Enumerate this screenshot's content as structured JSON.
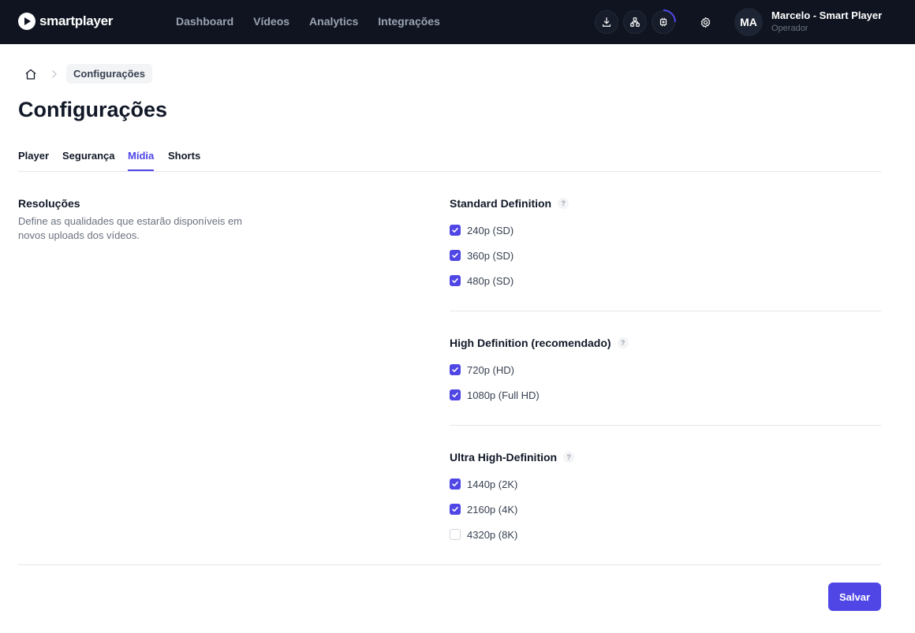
{
  "header": {
    "logo_text": "smartplayer",
    "nav": [
      "Dashboard",
      "Vídeos",
      "Analytics",
      "Integrações"
    ],
    "icons": [
      "download-icon",
      "network-icon",
      "chip-icon",
      "gear-icon"
    ],
    "user": {
      "initials": "MA",
      "name": "Marcelo - Smart Player",
      "role": "Operador"
    }
  },
  "breadcrumb": {
    "home_icon": "home-icon",
    "current": "Configurações"
  },
  "page": {
    "title": "Configurações"
  },
  "tabs": [
    {
      "label": "Player",
      "active": false
    },
    {
      "label": "Segurança",
      "active": false
    },
    {
      "label": "Mídia",
      "active": true
    },
    {
      "label": "Shorts",
      "active": false
    }
  ],
  "section": {
    "title": "Resoluções",
    "description": "Define as qualidades que estarão disponíveis em novos uploads dos vídeos."
  },
  "groups": [
    {
      "title": "Standard Definition",
      "help": "?",
      "options": [
        {
          "label": "240p (SD)",
          "checked": true
        },
        {
          "label": "360p (SD)",
          "checked": true
        },
        {
          "label": "480p (SD)",
          "checked": true
        }
      ]
    },
    {
      "title": "High Definition (recomendado)",
      "help": "?",
      "options": [
        {
          "label": "720p (HD)",
          "checked": true
        },
        {
          "label": "1080p (Full HD)",
          "checked": true
        }
      ]
    },
    {
      "title": "Ultra High-Definition",
      "help": "?",
      "options": [
        {
          "label": "1440p (2K)",
          "checked": true
        },
        {
          "label": "2160p (4K)",
          "checked": true
        },
        {
          "label": "4320p (8K)",
          "checked": false
        }
      ]
    }
  ],
  "actions": {
    "save_label": "Salvar"
  },
  "colors": {
    "accent": "#4f46e5",
    "topbar": "#0f1420"
  }
}
